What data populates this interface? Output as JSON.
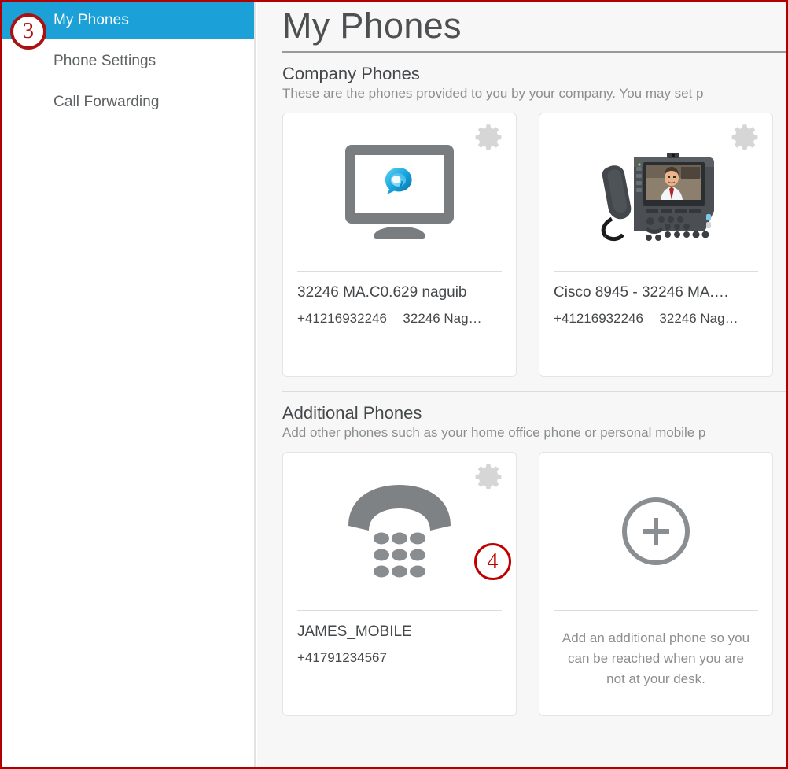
{
  "page": {
    "title": "My Phones",
    "border_color": "#b00000",
    "content_bg": "#f7f7f7",
    "accent_color": "#1ba0d7"
  },
  "sidebar": {
    "items": [
      {
        "label": "My Phones",
        "active": true,
        "name": "sidebar-item-my-phones"
      },
      {
        "label": "Phone Settings",
        "active": false,
        "name": "sidebar-item-phone-settings"
      },
      {
        "label": "Call Forwarding",
        "active": false,
        "name": "sidebar-item-call-forwarding"
      }
    ]
  },
  "sections": {
    "company": {
      "heading": "Company Phones",
      "description": "These are the phones provided to you by your company. You may set p",
      "cards": [
        {
          "icon": "softphone-monitor-icon",
          "title": "32246 MA.C0.629 naguib",
          "number": "+41216932246",
          "extra": "32246 Nag…",
          "gear": "gear-icon"
        },
        {
          "icon": "cisco-desk-phone-icon",
          "title": "Cisco 8945 - 32246 MA.…",
          "number": "+41216932246",
          "extra": "32246 Nag…",
          "gear": "gear-icon"
        }
      ]
    },
    "additional": {
      "heading": "Additional Phones",
      "description": "Add other phones such as your home office phone or personal mobile p",
      "cards": [
        {
          "icon": "keypad-phone-icon",
          "title": "JAMES_MOBILE",
          "number": "+41791234567",
          "extra": "",
          "gear": "gear-icon"
        }
      ],
      "add_card": {
        "icon": "plus-circle-icon",
        "text": "Add an additional phone so you can be reached when you are not at your desk."
      }
    }
  },
  "annotations": [
    {
      "label": "3",
      "name": "annotation-badge-3"
    },
    {
      "label": "4",
      "name": "annotation-badge-4"
    }
  ]
}
